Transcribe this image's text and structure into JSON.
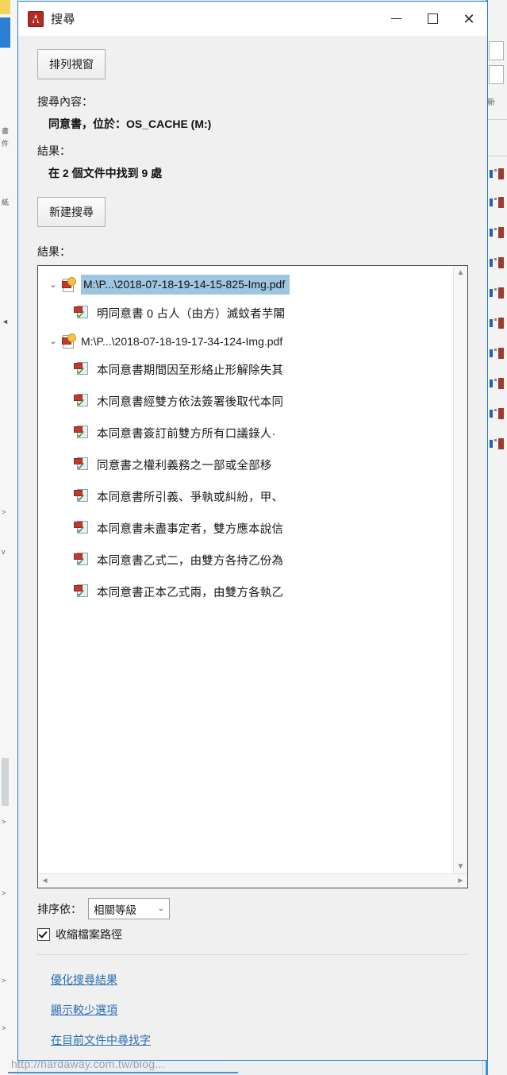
{
  "window": {
    "title": "搜尋",
    "icon": "acrobat-icon",
    "controls": {
      "minimize": "minimize-icon",
      "maximize": "maximize-icon",
      "close": "close-icon"
    }
  },
  "toolbar": {
    "arrange_windows_label": "排列視窗",
    "new_search_label": "新建搜尋"
  },
  "search_info": {
    "query_label": "搜尋內容：",
    "query_value": "同意書，位於：OS_CACHE (M:)",
    "results_label": "結果：",
    "results_value": "在 2 個文件中找到 9 處"
  },
  "results": {
    "heading": "結果：",
    "files": [
      {
        "name": "M:\\P...\\2018-07-18-19-14-15-825-Img.pdf",
        "selected": true,
        "expanded": true,
        "hits": [
          "明同意書 0 占人（由方）滅蚊者芋閣"
        ]
      },
      {
        "name": "M:\\P...\\2018-07-18-19-17-34-124-Img.pdf",
        "selected": false,
        "expanded": true,
        "hits": [
          "本同意書期間因至形絡止形解除失其",
          "木同意書經雙方依法簽署後取代本同",
          "本同意書簽訂前雙方所有口議錄人·",
          "同意書之權利義務之一部或全部移",
          "本同意書所引義、爭執或糾紛，甲、",
          "本同意書未盡事定者，雙方應本說信",
          "本同意書乙式二，由雙方各持乙份為",
          "本同意書正本乙式兩，由雙方各執乙"
        ]
      }
    ],
    "scrollbar": {
      "up": "scroll-up-icon",
      "down": "scroll-down-icon",
      "left": "scroll-left-icon",
      "right": "scroll-right-icon"
    }
  },
  "footer": {
    "sort_label": "排序依：",
    "sort_value": "相關等級",
    "collapse_path_label": "收縮檔案路徑",
    "collapse_path_checked": true,
    "links": [
      "優化搜尋結果",
      "顯示較少選項",
      "在目前文件中尋找字"
    ]
  },
  "watermark": {
    "text": "http://hardaway.com.tw/blog..."
  },
  "colors": {
    "selection": "#9fc6e0",
    "link": "#2a6fb5",
    "window_border": "#2b7cd3",
    "accent_red": "#b32b23"
  }
}
